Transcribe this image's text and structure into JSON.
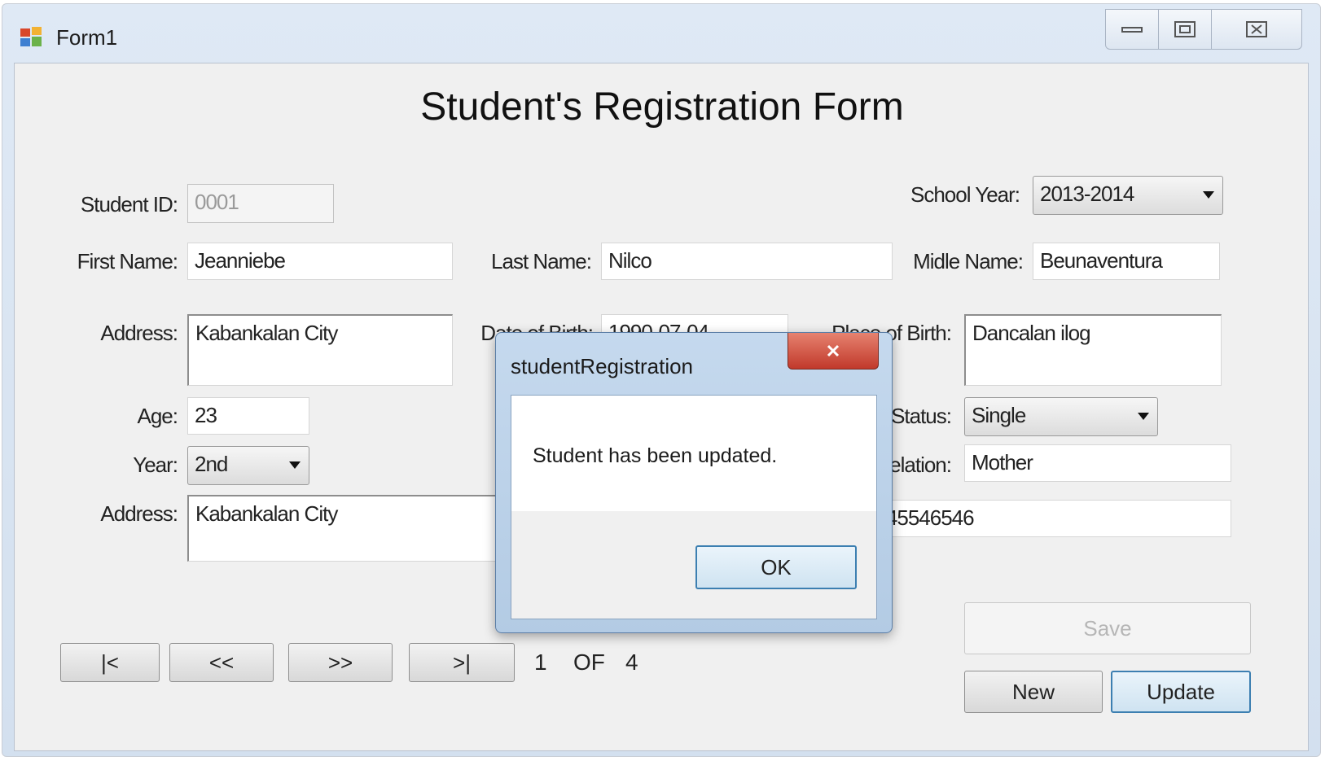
{
  "window": {
    "title": "Form1"
  },
  "form": {
    "title": "Student's Registration Form",
    "student_id": {
      "label": "Student ID:",
      "value": "0001"
    },
    "school_year": {
      "label": "School Year:",
      "value": "2013-2014"
    },
    "first_name": {
      "label": "First Name:",
      "value": "Jeanniebe"
    },
    "last_name": {
      "label": "Last Name:",
      "value": "Nilco"
    },
    "middle_name": {
      "label": "Midle Name:",
      "value": "Beunaventura"
    },
    "address": {
      "label": "Address:",
      "value": "Kabankalan City"
    },
    "date_of_birth": {
      "label": "Date of Birth:",
      "value": "1990-07-04"
    },
    "place_of_birth": {
      "label": "Place of Birth:",
      "value": "Dancalan ilog"
    },
    "age": {
      "label": "Age:",
      "value": "23"
    },
    "status": {
      "label": "Status:",
      "value": "Single"
    },
    "year": {
      "label": "Year:",
      "value": "2nd"
    },
    "relation": {
      "label": "Relation:",
      "value": "Mother"
    },
    "guardian_address": {
      "label": "Address:",
      "value": "Kabankalan City"
    },
    "contact": {
      "value": "6545546546"
    },
    "buttons": {
      "save": "Save",
      "new": "New",
      "update": "Update"
    },
    "pager": {
      "first": "|<",
      "prev": "<<",
      "next": ">>",
      "last": ">|",
      "current": "1",
      "of": "OF",
      "total": "4"
    }
  },
  "message_box": {
    "title": "studentRegistration",
    "message": "Student has been updated.",
    "ok": "OK"
  }
}
